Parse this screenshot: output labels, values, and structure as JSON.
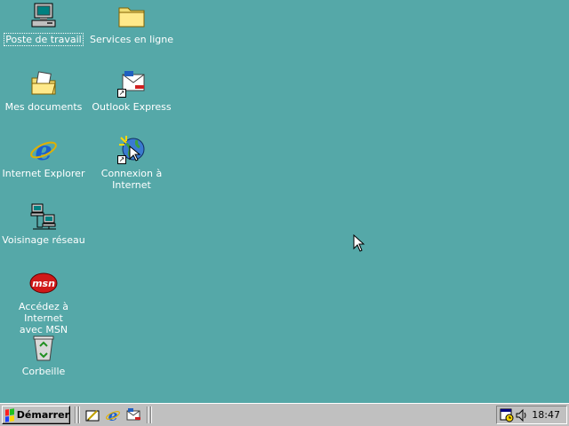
{
  "desktop": {
    "background": "#55a8a8",
    "icons": [
      {
        "label": "Poste de travail",
        "icon": "my-computer-icon"
      },
      {
        "label": "Services en ligne",
        "icon": "folder-icon"
      },
      {
        "label": "Mes documents",
        "icon": "my-documents-icon"
      },
      {
        "label": "Outlook Express",
        "icon": "outlook-express-icon"
      },
      {
        "label": "Internet Explorer",
        "icon": "internet-explorer-icon"
      },
      {
        "label": "Connexion à\nInternet",
        "icon": "connect-internet-icon"
      },
      {
        "label": "Voisinage réseau",
        "icon": "network-neighborhood-icon"
      },
      {
        "label": "Accédez à Internet\navec MSN",
        "icon": "msn-icon"
      },
      {
        "label": "Corbeille",
        "icon": "recycle-bin-icon"
      }
    ]
  },
  "taskbar": {
    "start_label": "Démarrer",
    "quick_launch": [
      "show-desktop-icon",
      "internet-explorer-icon",
      "outlook-express-icon"
    ],
    "tray": {
      "icons": [
        "scheduler-icon",
        "volume-icon"
      ],
      "clock": "18:47"
    }
  }
}
